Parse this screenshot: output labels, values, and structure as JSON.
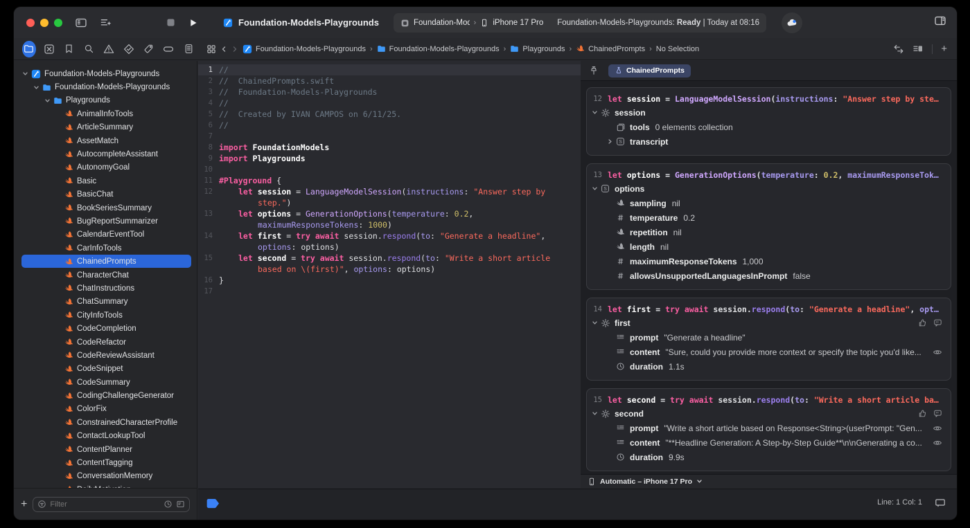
{
  "window": {
    "title": "Foundation-Models-Playgrounds",
    "scheme_name": "Foundation-Models-Playgr",
    "device": "iPhone 17 Pro",
    "status_prefix": "Foundation-Models-Playgrounds: ",
    "status_ready": "Ready",
    "status_suffix": " | Today at 08:16"
  },
  "navigator": {
    "tabs": [
      "project",
      "source-control",
      "bookmarks",
      "find",
      "issues",
      "tests",
      "debug",
      "breakpoints",
      "reports"
    ],
    "selected_tab": "project",
    "filter_placeholder": "Filter",
    "files": [
      {
        "name": "Foundation-Models-Playgrounds",
        "icon": "project",
        "indent": 0,
        "chevron": true
      },
      {
        "name": "Foundation-Models-Playgrounds",
        "icon": "folder",
        "indent": 1,
        "chevron": true
      },
      {
        "name": "Playgrounds",
        "icon": "folder",
        "indent": 2,
        "chevron": true
      },
      {
        "name": "AnimalInfoTools",
        "icon": "swift",
        "indent": 3
      },
      {
        "name": "ArticleSummary",
        "icon": "swift",
        "indent": 3
      },
      {
        "name": "AssetMatch",
        "icon": "swift",
        "indent": 3
      },
      {
        "name": "AutocompleteAssistant",
        "icon": "swift",
        "indent": 3
      },
      {
        "name": "AutonomyGoal",
        "icon": "swift",
        "indent": 3
      },
      {
        "name": "Basic",
        "icon": "swift",
        "indent": 3
      },
      {
        "name": "BasicChat",
        "icon": "swift",
        "indent": 3
      },
      {
        "name": "BookSeriesSummary",
        "icon": "swift",
        "indent": 3
      },
      {
        "name": "BugReportSummarizer",
        "icon": "swift",
        "indent": 3
      },
      {
        "name": "CalendarEventTool",
        "icon": "swift",
        "indent": 3
      },
      {
        "name": "CarInfoTools",
        "icon": "swift",
        "indent": 3
      },
      {
        "name": "ChainedPrompts",
        "icon": "swift",
        "indent": 3,
        "selected": true
      },
      {
        "name": "CharacterChat",
        "icon": "swift",
        "indent": 3
      },
      {
        "name": "ChatInstructions",
        "icon": "swift",
        "indent": 3
      },
      {
        "name": "ChatSummary",
        "icon": "swift",
        "indent": 3
      },
      {
        "name": "CityInfoTools",
        "icon": "swift",
        "indent": 3
      },
      {
        "name": "CodeCompletion",
        "icon": "swift",
        "indent": 3
      },
      {
        "name": "CodeRefactor",
        "icon": "swift",
        "indent": 3
      },
      {
        "name": "CodeReviewAssistant",
        "icon": "swift",
        "indent": 3
      },
      {
        "name": "CodeSnippet",
        "icon": "swift",
        "indent": 3
      },
      {
        "name": "CodeSummary",
        "icon": "swift",
        "indent": 3
      },
      {
        "name": "CodingChallengeGenerator",
        "icon": "swift",
        "indent": 3
      },
      {
        "name": "ColorFix",
        "icon": "swift",
        "indent": 3
      },
      {
        "name": "ConstrainedCharacterProfile",
        "icon": "swift",
        "indent": 3
      },
      {
        "name": "ContactLookupTool",
        "icon": "swift",
        "indent": 3
      },
      {
        "name": "ContentPlanner",
        "icon": "swift",
        "indent": 3
      },
      {
        "name": "ContentTagging",
        "icon": "swift",
        "indent": 3
      },
      {
        "name": "ConversationMemory",
        "icon": "swift",
        "indent": 3
      },
      {
        "name": "DailyMotivation",
        "icon": "swift",
        "indent": 3
      }
    ]
  },
  "editor": {
    "breadcrumb": [
      {
        "label": "Foundation-Models-Playgrounds",
        "icon": "project"
      },
      {
        "label": "Foundation-Models-Playgrounds",
        "icon": "folder"
      },
      {
        "label": "Playgrounds",
        "icon": "folder"
      },
      {
        "label": "ChainedPrompts",
        "icon": "swift"
      },
      {
        "label": "No Selection",
        "icon": null
      }
    ],
    "rows": [
      {
        "n": "1",
        "hl": true,
        "tok": [
          [
            "c",
            "//"
          ]
        ]
      },
      {
        "n": "2",
        "tok": [
          [
            "c",
            "//  ChainedPrompts.swift"
          ]
        ]
      },
      {
        "n": "3",
        "tok": [
          [
            "c",
            "//  Foundation-Models-Playgrounds"
          ]
        ]
      },
      {
        "n": "4",
        "tok": [
          [
            "c",
            "//"
          ]
        ]
      },
      {
        "n": "5",
        "tok": [
          [
            "c",
            "//  Created by IVAN CAMPOS on 6/11/25."
          ]
        ]
      },
      {
        "n": "6",
        "tok": [
          [
            "c",
            "//"
          ]
        ]
      },
      {
        "n": "7",
        "tok": []
      },
      {
        "n": "8",
        "tok": [
          [
            "k",
            "import"
          ],
          [
            "p",
            " "
          ],
          [
            "b",
            "FoundationModels"
          ]
        ]
      },
      {
        "n": "9",
        "tok": [
          [
            "k",
            "import"
          ],
          [
            "p",
            " "
          ],
          [
            "b",
            "Playgrounds"
          ]
        ]
      },
      {
        "n": "10",
        "tok": []
      },
      {
        "n": "11",
        "tok": [
          [
            "k",
            "#Playground"
          ],
          [
            "p",
            " {"
          ]
        ]
      },
      {
        "n": "12",
        "ind": 4,
        "tok": [
          [
            "k",
            "let"
          ],
          [
            "p",
            " "
          ],
          [
            "b",
            "session"
          ],
          [
            "p",
            " = "
          ],
          [
            "t",
            "LanguageModelSession"
          ],
          [
            "p",
            "("
          ],
          [
            "l",
            "instructions"
          ],
          [
            "p",
            ": "
          ],
          [
            "s",
            "\"Answer step by"
          ]
        ]
      },
      {
        "n": null,
        "ind": 8,
        "tok": [
          [
            "s",
            "step.\""
          ],
          [
            "p",
            ")"
          ]
        ]
      },
      {
        "n": "13",
        "ind": 4,
        "tok": [
          [
            "k",
            "let"
          ],
          [
            "p",
            " "
          ],
          [
            "b",
            "options"
          ],
          [
            "p",
            " = "
          ],
          [
            "t",
            "GenerationOptions"
          ],
          [
            "p",
            "("
          ],
          [
            "l",
            "temperature"
          ],
          [
            "p",
            ": "
          ],
          [
            "n",
            "0.2"
          ],
          [
            "p",
            ","
          ]
        ]
      },
      {
        "n": null,
        "ind": 8,
        "tok": [
          [
            "l",
            "maximumResponseTokens"
          ],
          [
            "p",
            ": "
          ],
          [
            "n",
            "1000"
          ],
          [
            "p",
            ")"
          ]
        ]
      },
      {
        "n": "14",
        "ind": 4,
        "tok": [
          [
            "k",
            "let"
          ],
          [
            "p",
            " "
          ],
          [
            "b",
            "first"
          ],
          [
            "p",
            " = "
          ],
          [
            "k",
            "try"
          ],
          [
            "p",
            " "
          ],
          [
            "k",
            "await"
          ],
          [
            "p",
            " session."
          ],
          [
            "m",
            "respond"
          ],
          [
            "p",
            "("
          ],
          [
            "l",
            "to"
          ],
          [
            "p",
            ": "
          ],
          [
            "s",
            "\"Generate a headline\""
          ],
          [
            "p",
            ","
          ]
        ]
      },
      {
        "n": null,
        "ind": 8,
        "tok": [
          [
            "l",
            "options"
          ],
          [
            "p",
            ": options)"
          ]
        ]
      },
      {
        "n": "15",
        "ind": 4,
        "tok": [
          [
            "k",
            "let"
          ],
          [
            "p",
            " "
          ],
          [
            "b",
            "second"
          ],
          [
            "p",
            " = "
          ],
          [
            "k",
            "try"
          ],
          [
            "p",
            " "
          ],
          [
            "k",
            "await"
          ],
          [
            "p",
            " session."
          ],
          [
            "m",
            "respond"
          ],
          [
            "p",
            "("
          ],
          [
            "l",
            "to"
          ],
          [
            "p",
            ": "
          ],
          [
            "s",
            "\"Write a short article"
          ]
        ]
      },
      {
        "n": null,
        "ind": 8,
        "tok": [
          [
            "s",
            "based on \\(first)\""
          ],
          [
            "p",
            ", "
          ],
          [
            "l",
            "options"
          ],
          [
            "p",
            ": options)"
          ]
        ]
      },
      {
        "n": "16",
        "tok": [
          [
            "p",
            "}"
          ]
        ]
      },
      {
        "n": "17",
        "tok": []
      }
    ]
  },
  "canvas": {
    "tab_label": "ChainedPrompts",
    "device_bar_label": "Automatic – iPhone 17 Pro",
    "cards": [
      {
        "line_no": "12",
        "line_tok": [
          [
            "k",
            "let"
          ],
          [
            "p",
            " "
          ],
          [
            "b",
            "session"
          ],
          [
            "p",
            " = "
          ],
          [
            "t",
            "LanguageModelSession"
          ],
          [
            "p",
            "("
          ],
          [
            "l",
            "instructions"
          ],
          [
            "p",
            ": "
          ],
          [
            "s",
            "\"Answer step by ste…"
          ]
        ],
        "rows": [
          {
            "chev": "down",
            "icon": "gear",
            "name": "session",
            "ind": 0
          },
          {
            "chev": "none",
            "icon": "collection",
            "name": "tools",
            "value": "0 elements collection",
            "ind": 1
          },
          {
            "chev": "right",
            "icon": "structS",
            "name": "transcript",
            "ind": 1
          }
        ]
      },
      {
        "line_no": "13",
        "line_tok": [
          [
            "k",
            "let"
          ],
          [
            "p",
            " "
          ],
          [
            "b",
            "options"
          ],
          [
            "p",
            " = "
          ],
          [
            "t",
            "GenerationOptions"
          ],
          [
            "p",
            "("
          ],
          [
            "l",
            "temperature"
          ],
          [
            "p",
            ": "
          ],
          [
            "n",
            "0.2"
          ],
          [
            "p",
            ", "
          ],
          [
            "l",
            "maximumResponseTok…"
          ]
        ],
        "rows": [
          {
            "chev": "down",
            "icon": "structS",
            "name": "options",
            "ind": 0
          },
          {
            "chev": "none",
            "icon": "swiftmono",
            "name": "sampling",
            "value": "nil",
            "ind": 1
          },
          {
            "chev": "none",
            "icon": "hash",
            "name": "temperature",
            "value": "0.2",
            "ind": 1
          },
          {
            "chev": "none",
            "icon": "swiftmono",
            "name": "repetition",
            "value": "nil",
            "ind": 1
          },
          {
            "chev": "none",
            "icon": "swiftmono",
            "name": "length",
            "value": "nil",
            "ind": 1
          },
          {
            "chev": "none",
            "icon": "hash",
            "name": "maximumResponseTokens",
            "value": "1,000",
            "ind": 1
          },
          {
            "chev": "none",
            "icon": "hash",
            "name": "allowsUnsupportedLanguagesInPrompt",
            "value": "false",
            "ind": 1
          }
        ]
      },
      {
        "line_no": "14",
        "line_tok": [
          [
            "k",
            "let"
          ],
          [
            "p",
            " "
          ],
          [
            "b",
            "first"
          ],
          [
            "p",
            " = "
          ],
          [
            "k",
            "try"
          ],
          [
            "p",
            " "
          ],
          [
            "k",
            "await"
          ],
          [
            "p",
            " session."
          ],
          [
            "m",
            "respond"
          ],
          [
            "p",
            "("
          ],
          [
            "l",
            "to"
          ],
          [
            "p",
            ": "
          ],
          [
            "s",
            "\"Generate a headline\""
          ],
          [
            "p",
            ", "
          ],
          [
            "l",
            "opt…"
          ]
        ],
        "rows": [
          {
            "chev": "down",
            "icon": "gear",
            "name": "first",
            "ind": 0,
            "right": [
              "thumb",
              "quote"
            ]
          },
          {
            "chev": "none",
            "icon": "textlines",
            "name": "prompt",
            "value": "\"Generate a headline\"",
            "ind": 1
          },
          {
            "chev": "none",
            "icon": "textlines",
            "name": "content",
            "value": "\"Sure, could you provide more context or specify the topic you'd like...",
            "ind": 1,
            "right": [
              "eye"
            ]
          },
          {
            "chev": "none",
            "icon": "clock",
            "name": "duration",
            "value": "1.1s",
            "ind": 1
          }
        ]
      },
      {
        "line_no": "15",
        "line_tok": [
          [
            "k",
            "let"
          ],
          [
            "p",
            " "
          ],
          [
            "b",
            "second"
          ],
          [
            "p",
            " = "
          ],
          [
            "k",
            "try"
          ],
          [
            "p",
            " "
          ],
          [
            "k",
            "await"
          ],
          [
            "p",
            " session."
          ],
          [
            "m",
            "respond"
          ],
          [
            "p",
            "("
          ],
          [
            "l",
            "to"
          ],
          [
            "p",
            ": "
          ],
          [
            "s",
            "\"Write a short article ba…"
          ]
        ],
        "rows": [
          {
            "chev": "down",
            "icon": "gear",
            "name": "second",
            "ind": 0,
            "right": [
              "thumb",
              "quote"
            ]
          },
          {
            "chev": "none",
            "icon": "textlines",
            "name": "prompt",
            "value": "\"Write a short article based on Response<String>(userPrompt: \"Gen...",
            "ind": 1,
            "right": [
              "eye"
            ]
          },
          {
            "chev": "none",
            "icon": "textlines",
            "name": "content",
            "value": "\"**Headline Generation: A Step-by-Step Guide**\\n\\nGenerating a co...",
            "ind": 1,
            "right": [
              "eye"
            ]
          },
          {
            "chev": "none",
            "icon": "clock",
            "name": "duration",
            "value": "9.9s",
            "ind": 1
          }
        ]
      }
    ]
  },
  "statusbar": {
    "line_col": "Line: 1  Col: 1"
  },
  "colors": {
    "accent": "#2b66d9",
    "swift_orange": "#f37335",
    "folder_blue": "#3f99f7",
    "run_blue": "#3b82f7",
    "keyword_pink": "#fc5fa3",
    "string_red": "#fc6a5d"
  }
}
